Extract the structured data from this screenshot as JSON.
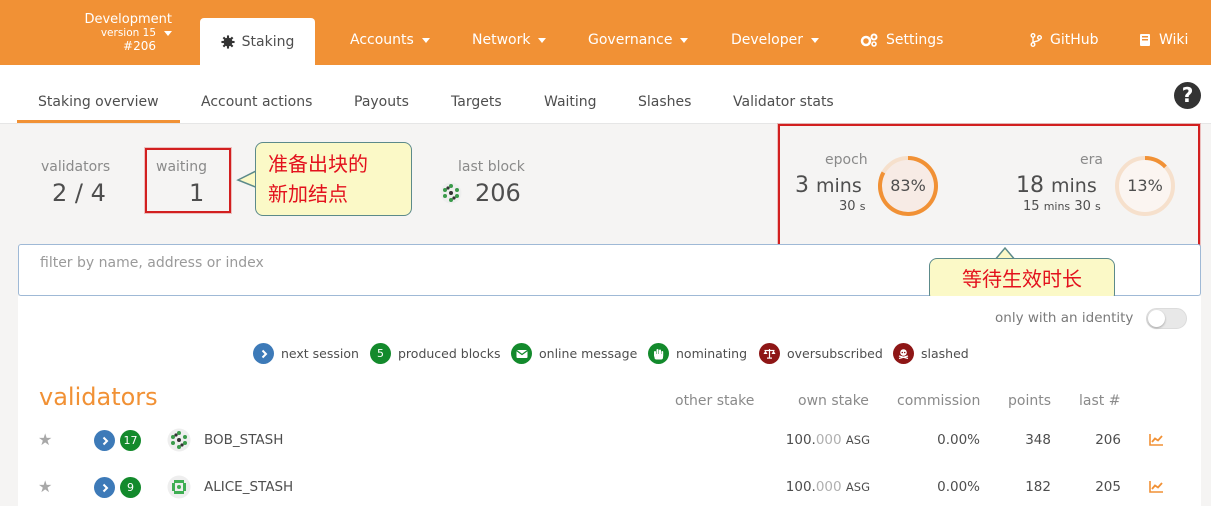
{
  "chain": {
    "name": "Development",
    "version": "version 15",
    "block": "#206"
  },
  "topnav": {
    "active_tab": "Staking",
    "items": [
      "Accounts",
      "Network",
      "Governance",
      "Developer",
      "Settings"
    ],
    "right": [
      "GitHub",
      "Wiki"
    ]
  },
  "subnav": {
    "tabs": [
      "Staking overview",
      "Account actions",
      "Payouts",
      "Targets",
      "Waiting",
      "Slashes",
      "Validator stats"
    ],
    "help": "?"
  },
  "summary": {
    "validators_label": "validators",
    "validators_value": "2 / 4",
    "waiting_label": "waiting",
    "waiting_value": "1",
    "last_block_label": "last block",
    "last_block_value": "206",
    "epoch_label": "epoch",
    "epoch_value": "3",
    "epoch_unit": "mins",
    "epoch_sub": "30",
    "epoch_sub_unit": "s",
    "epoch_percent": "83%",
    "epoch_progress": 0.83,
    "era_label": "era",
    "era_value": "18",
    "era_unit": "mins",
    "era_sub_a": "15",
    "era_sub_a_unit": "mins",
    "era_sub_b": "30",
    "era_sub_b_unit": "s",
    "era_percent": "13%",
    "era_progress": 0.13
  },
  "annotations": {
    "callout1_line1": "准备出块的",
    "callout1_line2": "新加结点",
    "callout2": "等待生效时长"
  },
  "filter": {
    "placeholder": "filter by name, address or index"
  },
  "identity_toggle": {
    "label": "only with an identity",
    "on": false
  },
  "legend": [
    {
      "icon": "chevron-right",
      "label": "next session",
      "color": "#3d7ab8"
    },
    {
      "icon": "5",
      "label": "produced blocks",
      "color": "#138a2c"
    },
    {
      "icon": "envelope",
      "label": "online message",
      "color": "#138a2c"
    },
    {
      "icon": "hand",
      "label": "nominating",
      "color": "#138a2c"
    },
    {
      "icon": "balance-scale",
      "label": "oversubscribed",
      "color": "#8e1616"
    },
    {
      "icon": "skull",
      "label": "slashed",
      "color": "#8e1616"
    }
  ],
  "table": {
    "title": "validators",
    "headers": [
      "other stake",
      "own stake",
      "commission",
      "points",
      "last #"
    ],
    "rows": [
      {
        "blocks": "17",
        "name": "BOB_STASH",
        "own_int": "100.",
        "own_dec": "000",
        "own_unit": "ASG",
        "commission": "0.00%",
        "points": "348",
        "last": "206"
      },
      {
        "blocks": "9",
        "name": "ALICE_STASH",
        "own_int": "100.",
        "own_dec": "000",
        "own_unit": "ASG",
        "commission": "0.00%",
        "points": "182",
        "last": "205"
      }
    ]
  },
  "colors": {
    "accent": "#f19135",
    "annotation_red": "#d21f1f",
    "blue": "#3d7ab8",
    "green": "#138a2c",
    "dark_red": "#8e1616"
  }
}
